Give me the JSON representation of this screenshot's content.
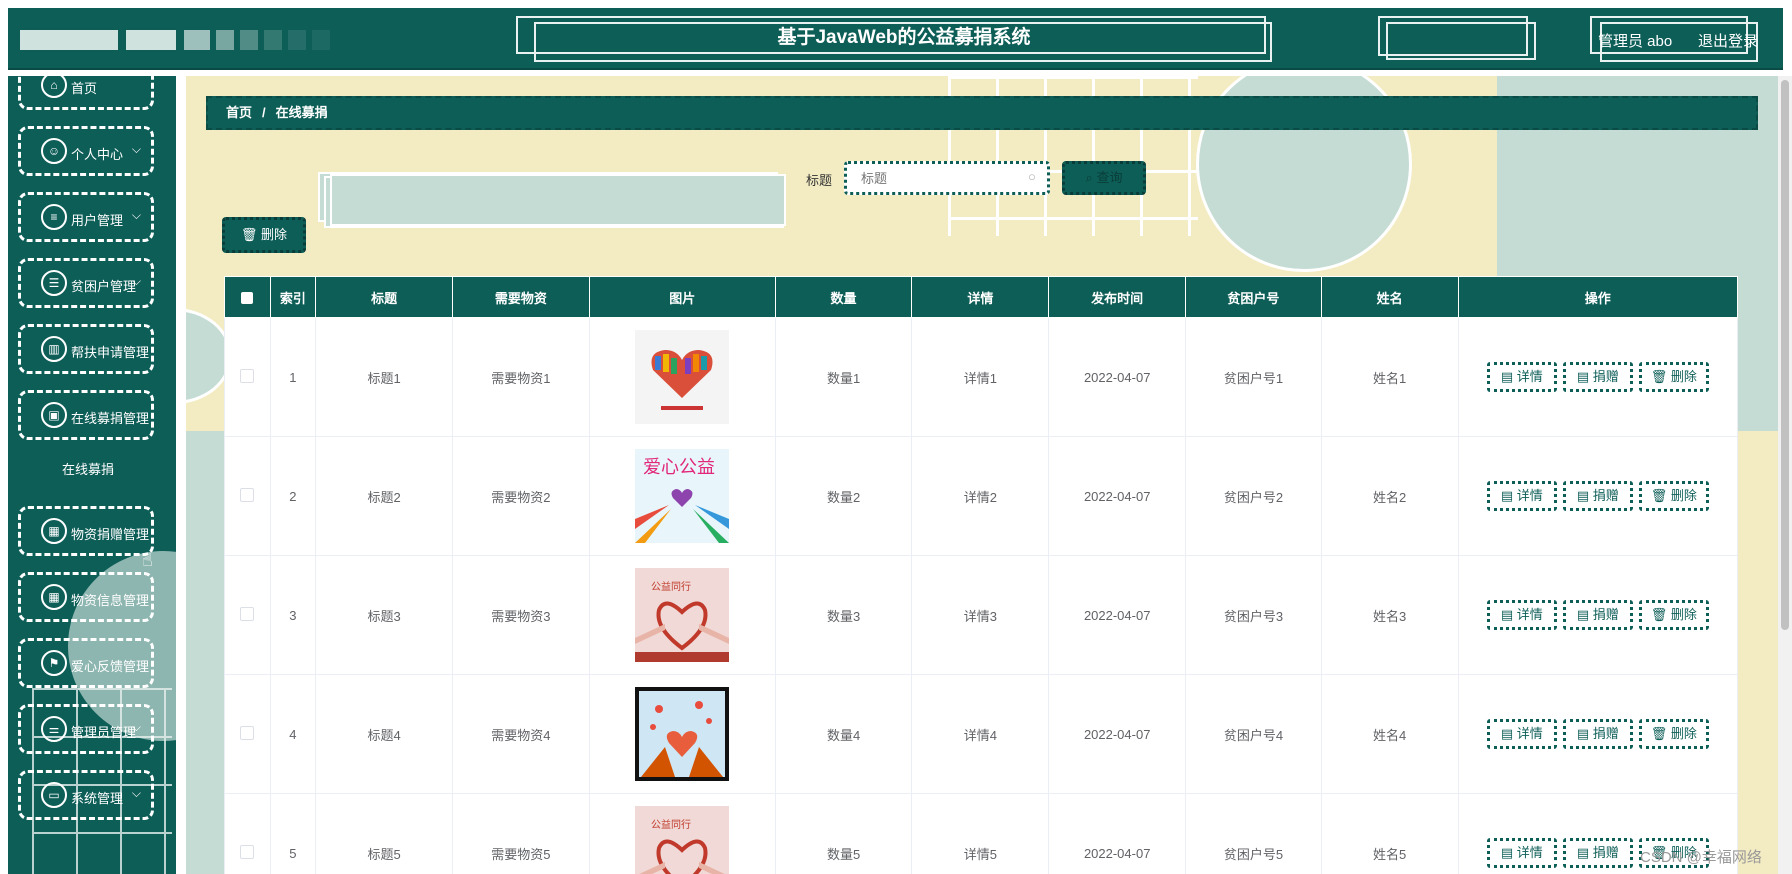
{
  "header": {
    "title": "基于JavaWeb的公益募捐系统",
    "user_label": "管理员 abo",
    "logout_label": "退出登录"
  },
  "sidebar": {
    "items": [
      {
        "label": "首页",
        "icon": "home-icon",
        "has_arrow": false
      },
      {
        "label": "个人中心",
        "icon": "user-icon",
        "has_arrow": true
      },
      {
        "label": "用户管理",
        "icon": "list-icon",
        "has_arrow": true
      },
      {
        "label": "贫困户管理",
        "icon": "list-icon",
        "has_arrow": true
      },
      {
        "label": "帮扶申请管理",
        "icon": "chart-icon",
        "has_arrow": false
      },
      {
        "label": "在线募捐管理",
        "icon": "document-icon",
        "has_arrow": false
      },
      {
        "label": "物资捐赠管理",
        "icon": "grid-icon",
        "has_arrow": false
      },
      {
        "label": "物资信息管理",
        "icon": "grid-icon",
        "has_arrow": false
      },
      {
        "label": "爱心反馈管理",
        "icon": "flag-icon",
        "has_arrow": false
      },
      {
        "label": "管理员管理",
        "icon": "sliders-icon",
        "has_arrow": true
      },
      {
        "label": "系统管理",
        "icon": "monitor-icon",
        "has_arrow": true
      }
    ],
    "submenu_active": "在线募捐"
  },
  "breadcrumb": {
    "home": "首页",
    "separator": "/",
    "current": "在线募捐"
  },
  "search": {
    "label": "标题",
    "placeholder": "标题",
    "button_label": "查询"
  },
  "bulk_delete_label": "删除",
  "table": {
    "columns": [
      "索引",
      "标题",
      "需要物资",
      "图片",
      "数量",
      "详情",
      "发布时间",
      "贫困户号",
      "姓名",
      "操作"
    ],
    "rows": [
      {
        "index": "1",
        "title": "标题1",
        "material": "需要物资1",
        "image": "heart-books",
        "qty": "数量1",
        "detail": "详情1",
        "date": "2022-04-07",
        "household": "贫困户号1",
        "name": "姓名1"
      },
      {
        "index": "2",
        "title": "标题2",
        "material": "需要物资2",
        "image": "hands-heart-poster",
        "qty": "数量2",
        "detail": "详情2",
        "date": "2022-04-07",
        "household": "贫困户号2",
        "name": "姓名2"
      },
      {
        "index": "3",
        "title": "标题3",
        "material": "需要物资3",
        "image": "red-ribbon-hands",
        "qty": "数量3",
        "detail": "详情3",
        "date": "2022-04-07",
        "household": "贫困户号3",
        "name": "姓名3"
      },
      {
        "index": "4",
        "title": "标题4",
        "material": "需要物资4",
        "image": "butterfly-hands-heart",
        "qty": "数量4",
        "detail": "详情4",
        "date": "2022-04-07",
        "household": "贫困户号4",
        "name": "姓名4"
      },
      {
        "index": "5",
        "title": "标题5",
        "material": "需要物资5",
        "image": "red-ribbon-hands",
        "qty": "数量5",
        "detail": "详情5",
        "date": "2022-04-07",
        "household": "贫困户号5",
        "name": "姓名5"
      }
    ],
    "actions": [
      "详情",
      "捐赠",
      "删除"
    ]
  },
  "watermark": "CSDN @幸福网络",
  "colors": {
    "primary": "#0e5e58",
    "main_bg": "#f3ecc3",
    "accent_light": "#c5dcd5"
  }
}
